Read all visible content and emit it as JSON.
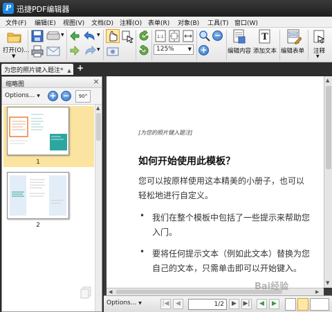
{
  "window": {
    "title": "迅捷PDF编辑器",
    "logo_letter": "P"
  },
  "menu": [
    "文件(F)",
    "编辑(E)",
    "视图(V)",
    "文档(D)",
    "注释(O)",
    "表单(R)",
    "对象(B)",
    "工具(T)",
    "窗口(W)"
  ],
  "toolbar": {
    "open_label": "打开(O)...",
    "zoom_value": "125%",
    "edit_content_label": "编辑内容",
    "add_text_label": "添加文本",
    "edit_form_label": "编辑表单",
    "annotation_label": "注释",
    "rotate_label": "90°",
    "accent": "#2f6fc7"
  },
  "tab": {
    "title": "为您的照片键入题注",
    "modified_mark": "*",
    "new_tab": "+"
  },
  "thumbnails": {
    "panel_title": "缩略图",
    "options_label": "Options...",
    "rotate_label": "90°",
    "zoom_in": "+",
    "zoom_out": "−",
    "pages": [
      "1",
      "2"
    ],
    "selected_bg": "#fbe3a0"
  },
  "document": {
    "placeholder": "[为您的照片键入题注]",
    "heading": "如何开始使用此模板？",
    "paragraph": "您可以按原样使用这本精美的小册子，也可以轻松地进行自定义。",
    "bullets": [
      "我们在整个模板中包括了一些提示来帮助您入门。",
      "要将任何提示文本（例如此文本）替换为您自己的文本，只需单击即可以开始键入。"
    ]
  },
  "navigation": {
    "options_label": "Options...",
    "current_page": "1",
    "total_pages": "2",
    "separator": "/"
  },
  "watermark": "Bai经验"
}
